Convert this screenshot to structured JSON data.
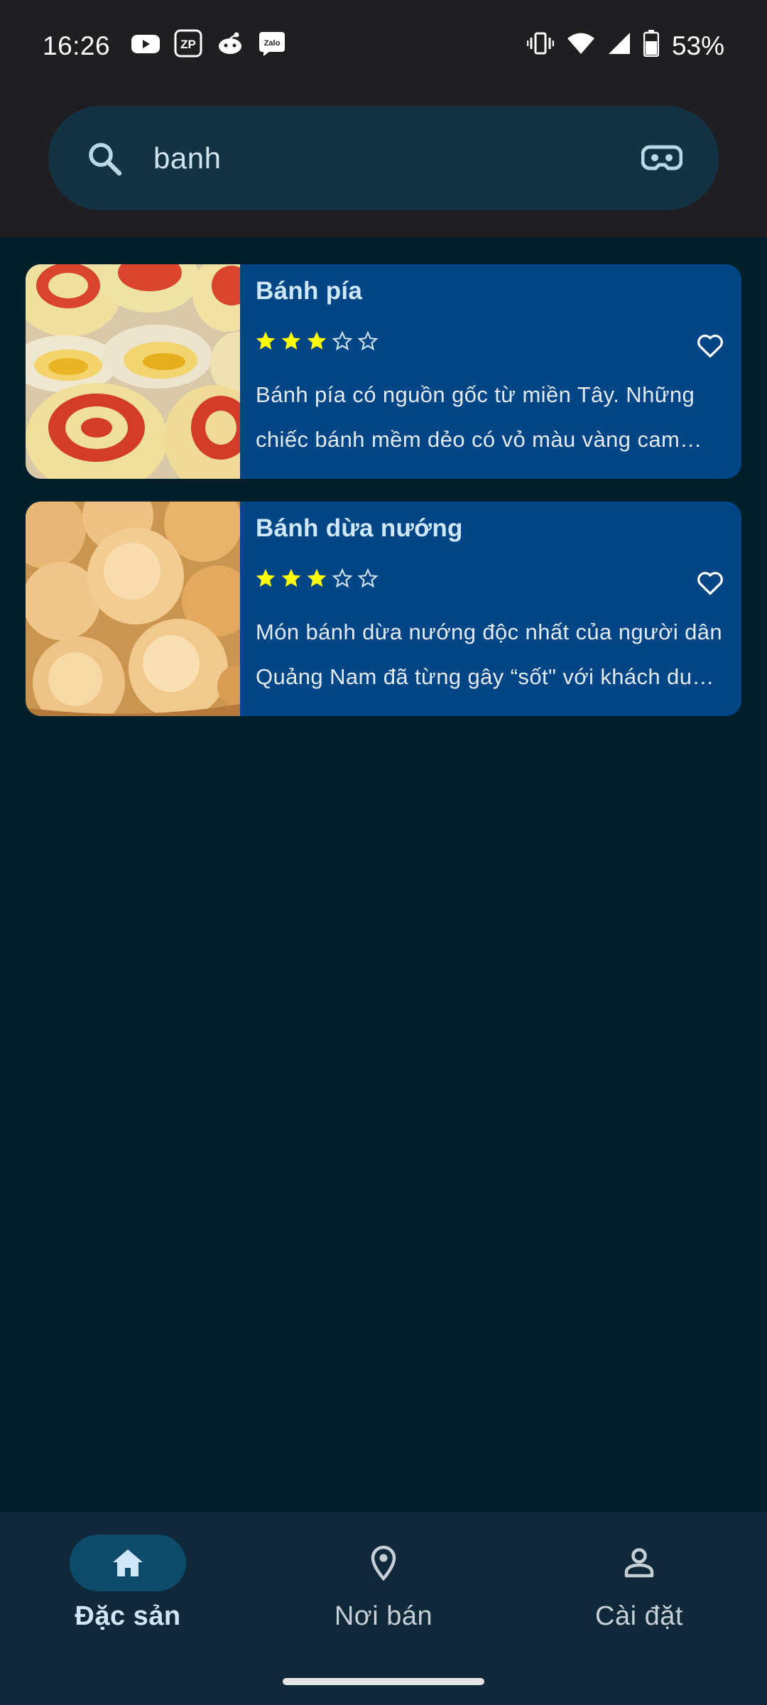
{
  "status_bar": {
    "time": "16:26",
    "app_icons": [
      "youtube-icon",
      "zalopay-icon",
      "reddit-icon",
      "zalo-icon"
    ],
    "zalopay_label": "ZP",
    "zalo_label": "Zalo",
    "system_icons": [
      "vibrate-icon",
      "wifi-icon",
      "signal-icon",
      "battery-icon"
    ],
    "battery": "53%"
  },
  "search": {
    "query": "banh",
    "leading_icon": "search-icon",
    "trailing_icon": "eye-mask-icon"
  },
  "results": [
    {
      "title": "Bánh pía",
      "rating": 3,
      "rating_max": 5,
      "favorite": false,
      "description": "Bánh pía có nguồn gốc từ miền Tây. Những chiếc bánh mềm dẻo có vỏ màu vàng cam nhạt, nhân sầu riêng và trứng muối béo ngậy."
    },
    {
      "title": "Bánh dừa nướng",
      "rating": 3,
      "rating_max": 5,
      "favorite": false,
      "description": "Món bánh dừa nướng độc nhất của người dân Quảng Nam đã từng gây “sốt\" với khách du lịch gần xa."
    }
  ],
  "bottom_nav": {
    "items": [
      {
        "label": "Đặc sản",
        "icon": "home-icon",
        "active": true
      },
      {
        "label": "Nơi bán",
        "icon": "location-pin-icon",
        "active": false
      },
      {
        "label": "Cài đặt",
        "icon": "person-icon",
        "active": false
      }
    ]
  },
  "colors": {
    "background": "#001f2a",
    "card": "#004585",
    "star_filled": "#ffff00",
    "accent_title": "#cfe8ff",
    "nav_active_pill": "#0e4a6a"
  }
}
